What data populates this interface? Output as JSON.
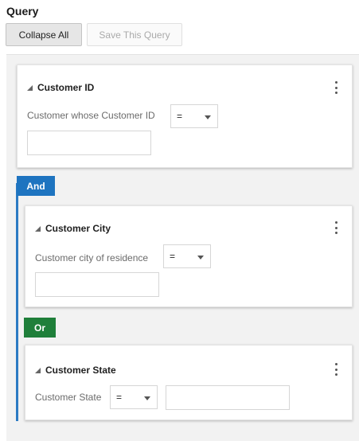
{
  "query": {
    "title": "Query",
    "collapse_all_label": "Collapse All",
    "save_query_label": "Save This Query"
  },
  "colors": {
    "and_tag": "#1e74c0",
    "or_tag": "#1f7f3a",
    "connector": "#2c7bc3"
  },
  "conditions": [
    {
      "title": "Customer ID",
      "label": "Customer whose Customer ID",
      "operator": "=",
      "value": ""
    },
    {
      "connector": "And",
      "title": "Customer City",
      "label": "Customer city of residence",
      "operator": "=",
      "value": ""
    },
    {
      "connector": "Or",
      "title": "Customer State",
      "label": "Customer State",
      "operator": "=",
      "value": ""
    }
  ],
  "icons": {
    "collapse": "collapse-triangle-icon",
    "menu": "kebab-menu-icon",
    "dropdown": "chevron-down-icon"
  }
}
